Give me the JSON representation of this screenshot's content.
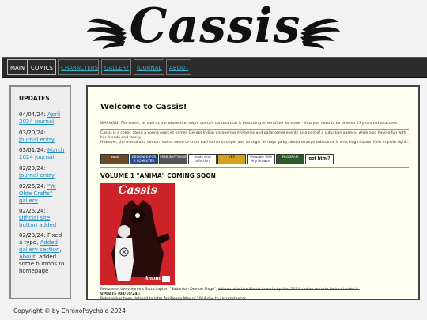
{
  "site": {
    "logo": "Cassis"
  },
  "nav": {
    "items": [
      {
        "label": "MAIN"
      },
      {
        "label": "COMICS"
      },
      {
        "label": "CHARACTERS"
      },
      {
        "label": "GALLERY"
      },
      {
        "label": "JOURNAL"
      },
      {
        "label": "ABOUT"
      }
    ]
  },
  "sidebar": {
    "title": "UPDATES",
    "updates": [
      {
        "date": "04/04/24:",
        "text": "April 2024 journal",
        "linked": true
      },
      {
        "date": "03/20/24:",
        "text": "Journal entry",
        "linked": true
      },
      {
        "date": "03/01/24:",
        "text": "March 2024 Journal",
        "linked": true
      },
      {
        "date": "02/29/24:",
        "text": "Journal entry",
        "linked": true
      },
      {
        "date": "02/26/24:",
        "text": "\"Ye Olde Crafts\" gallery",
        "linked": true
      },
      {
        "date": "02/25/24:",
        "text": "Official site button added",
        "linked": true
      },
      {
        "date": "02/23/24:",
        "pre": "Fixed a typo,",
        "link1": "Added gallery section",
        "mid": ",",
        "link2": "About",
        "post": ", added some buttons to homepage"
      }
    ]
  },
  "main": {
    "heading": "Welcome to Cassis!",
    "warning": "WARNING! The comic, as well as the whole site, might contain content that is disturbing or sensitive for some - thus you need to be at least 15 years old to access.",
    "intro1": "Cassis is a comic about a young exorcist named Decept Indion uncovering mysteries and paranormal events as a part of a suburban agency, while also having fun with her friends and family.",
    "intro2": "However, the mortal and demon realms seem to cross each other stronger and stronger as days go by, and a strange substance is wrecking citizens' lives in plain sight...",
    "badges": [
      {
        "label": "awoo",
        "color": "#6b4a2a"
      },
      {
        "label": "DESIGNED FOR A COMPUTER",
        "color": "#2a4a8a"
      },
      {
        "label": "FREE SOFTWARE",
        "color": "#555"
      },
      {
        "label": "made with affection",
        "color": "#ffffff"
      },
      {
        "label": "YES",
        "color": "#d6a020"
      },
      {
        "label": "Viewable With Any Browser",
        "color": "#ffffff"
      },
      {
        "label": "PROGRAM",
        "color": "#2a5a2a"
      },
      {
        "label": "got html?",
        "color": "#ffffff"
      }
    ],
    "volume_title": "VOLUME 1 \"ANIMA\" COMING SOON",
    "cover_title": "Cassis",
    "cover_sub": "Anima",
    "release_text": "Release of the volume's first chapter, \"Suburban Demon Siege\",",
    "release_strike": "will occur in late March to early April of 2024, unless outside factors hinder it.",
    "update_label": "UPDATE (04/10/24):",
    "update_text": "Release has been delayed to later April/early May of 2024 due to circumstances."
  },
  "footer": {
    "text": "Copyright © by ChronoPsychoid 2024"
  }
}
